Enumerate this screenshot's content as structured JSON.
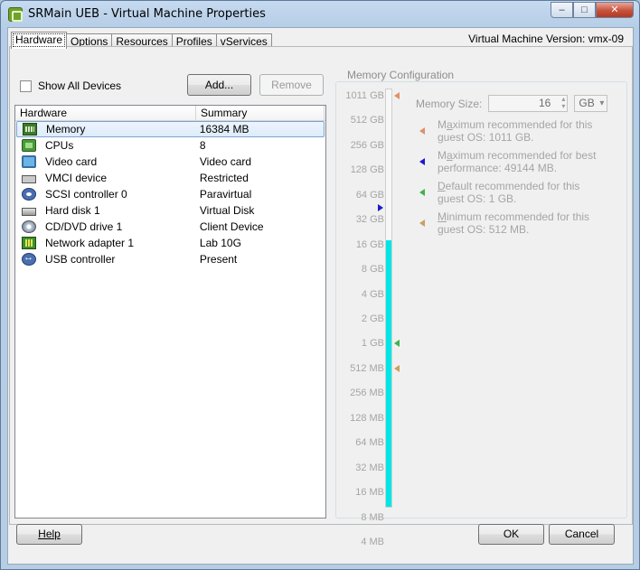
{
  "window": {
    "title": "SRMain UEB - Virtual Machine Properties",
    "controls": {
      "minimize": "–",
      "restore": "□",
      "close": "✕"
    }
  },
  "tabs": [
    "Hardware",
    "Options",
    "Resources",
    "Profiles",
    "vServices"
  ],
  "active_tab": "Hardware",
  "vm_version": "Virtual Machine Version: vmx-09",
  "hardware": {
    "show_all_devices_label": "Show All Devices",
    "show_all_devices_checked": false,
    "add_label": "Add...",
    "remove_label": "Remove",
    "columns": {
      "hardware": "Hardware",
      "summary": "Summary"
    },
    "rows": [
      {
        "name": "Memory",
        "summary": "16384 MB",
        "icon": "memory-icon",
        "selected": true
      },
      {
        "name": "CPUs",
        "summary": "8",
        "icon": "cpu-icon"
      },
      {
        "name": "Video card",
        "summary": "Video card",
        "icon": "monitor-icon"
      },
      {
        "name": "VMCI device",
        "summary": "Restricted",
        "icon": "vmci-device-icon"
      },
      {
        "name": "SCSI controller 0",
        "summary": "Paravirtual",
        "icon": "scsi-controller-icon"
      },
      {
        "name": "Hard disk 1",
        "summary": "Virtual Disk",
        "icon": "hard-disk-icon"
      },
      {
        "name": "CD/DVD drive 1",
        "summary": "Client Device",
        "icon": "cd-dvd-icon"
      },
      {
        "name": "Network adapter 1",
        "summary": "Lab 10G",
        "icon": "network-adapter-icon"
      },
      {
        "name": "USB controller",
        "summary": "Present",
        "icon": "usb-controller-icon"
      }
    ]
  },
  "memory": {
    "group_title": "Memory Configuration",
    "size_label": "Memory Size:",
    "size_value": "16",
    "unit": "GB",
    "scale_labels": [
      "1011 GB",
      "512 GB",
      "256 GB",
      "128 GB",
      "64 GB",
      "32 GB",
      "16 GB",
      "8 GB",
      "4 GB",
      "2 GB",
      "1 GB",
      "512 MB",
      "256 MB",
      "128 MB",
      "64 MB",
      "32 MB",
      "16 MB",
      "8 MB",
      "4 MB"
    ],
    "current_level_index": 6,
    "markers": [
      {
        "label_index": 0,
        "color": "#e0906a",
        "side": "right"
      },
      {
        "label_index": 4.5,
        "color": "#1a1acc",
        "side": "left"
      },
      {
        "label_index": 10,
        "color": "#3cb44a",
        "side": "right"
      },
      {
        "label_index": 11,
        "color": "#c8a060",
        "side": "right"
      }
    ],
    "recommendations": [
      {
        "text": "Maximum recommended for this guest OS: 1011 GB.",
        "accel": "a",
        "color": "#e0906a"
      },
      {
        "text": "Maximum recommended for best performance: 49144 MB.",
        "accel": "a",
        "color": "#1a1acc"
      },
      {
        "text": "Default recommended for this guest OS: 1 GB.",
        "accel": "D",
        "color": "#3cb44a"
      },
      {
        "text": "Minimum recommended for this guest OS: 512 MB.",
        "accel": "M",
        "color": "#c8a060"
      }
    ]
  },
  "footer": {
    "help": "Help",
    "ok": "OK",
    "cancel": "Cancel"
  },
  "colors": {
    "fill": "#00e6e6",
    "accent_selection": "#7da2ce"
  }
}
